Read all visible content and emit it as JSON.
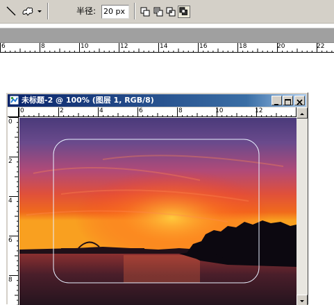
{
  "options_bar": {
    "radius_label": "半径:",
    "radius_value": "20 px",
    "tools": [
      "line-tool-icon",
      "custom-shape-tool-icon"
    ],
    "modes": [
      "new-shape-mode-icon",
      "add-to-shape-mode-icon",
      "intersect-shape-mode-icon",
      "exclude-shape-mode-icon"
    ],
    "active_mode": 3
  },
  "top_ruler": {
    "labels": [
      "6",
      "8",
      "10",
      "12",
      "14",
      "16",
      "18",
      "20",
      "22"
    ]
  },
  "document": {
    "title": "未标题-2 @ 100% (图层 1, RGB/8)",
    "ruler_h_labels": [
      "0",
      "2",
      "4",
      "6",
      "8",
      "10",
      "12"
    ],
    "ruler_v_labels": [
      "0",
      "2",
      "4",
      "6",
      "8"
    ]
  },
  "colors": {
    "title_bar_start": "#0a246a",
    "title_bar_end": "#a6caf0",
    "panel_gray": "#d4d0c8",
    "path_outline": "#e8f0ff"
  }
}
